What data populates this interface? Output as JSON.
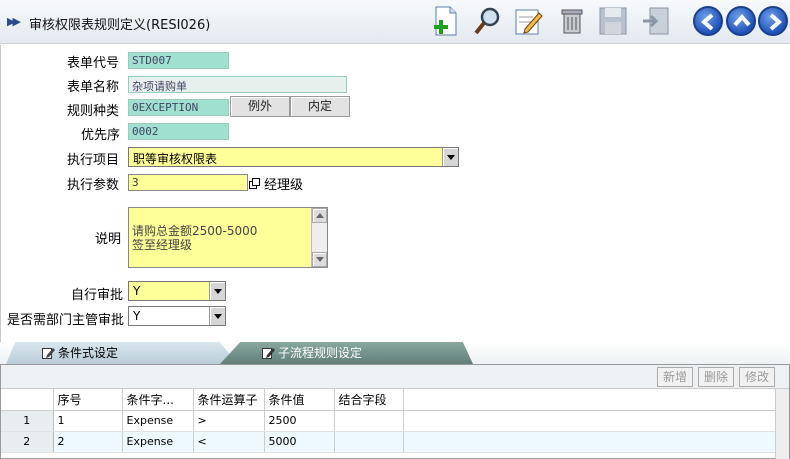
{
  "header": {
    "title": "审核权限表规则定义(RESI026)"
  },
  "toolbar": {
    "icons": [
      "add-doc-icon",
      "search-icon",
      "edit-icon",
      "delete-icon",
      "save-icon",
      "exit-icon"
    ],
    "nav": [
      "back-icon",
      "up-icon",
      "forward-icon"
    ]
  },
  "form": {
    "form_code": {
      "label": "表单代号",
      "value": "STD007"
    },
    "form_name": {
      "label": "表单名称",
      "value": "杂项请购单"
    },
    "rule_type": {
      "label": "规则种类",
      "value": "0EXCEPTION",
      "btn_exception": "例外",
      "btn_default": "内定"
    },
    "priority": {
      "label": "优先序",
      "value": "0002"
    },
    "exec_item": {
      "label": "执行项目",
      "value": "职等审核权限表"
    },
    "exec_param": {
      "label": "执行参数",
      "value": "3",
      "suffix": "经理级"
    },
    "description": {
      "label": "说明",
      "value": "请购总金额2500-5000\n签至经理级"
    },
    "self_approve": {
      "label": "自行审批",
      "value": "Y"
    },
    "dept_head_approve": {
      "label": "是否需部门主管审批",
      "value": "Y"
    }
  },
  "tabs": [
    {
      "label": "条件式设定"
    },
    {
      "label": "子流程规则设定"
    }
  ],
  "grid": {
    "buttons": {
      "add": "新增",
      "delete": "删除",
      "modify": "修改"
    },
    "columns": [
      "序号",
      "条件字...",
      "条件运算子",
      "条件值",
      "结合字段"
    ],
    "rows": [
      {
        "rownum": "1",
        "seq": "1",
        "field": "Expense",
        "op": ">",
        "value": "2500",
        "join": ""
      },
      {
        "rownum": "2",
        "seq": "2",
        "field": "Expense",
        "op": "<",
        "value": "5000",
        "join": ""
      }
    ]
  },
  "colors": {
    "readonly_field": "#9fe0cf",
    "editable_field": "#ffff99",
    "nav_button": "#1f52b8"
  }
}
